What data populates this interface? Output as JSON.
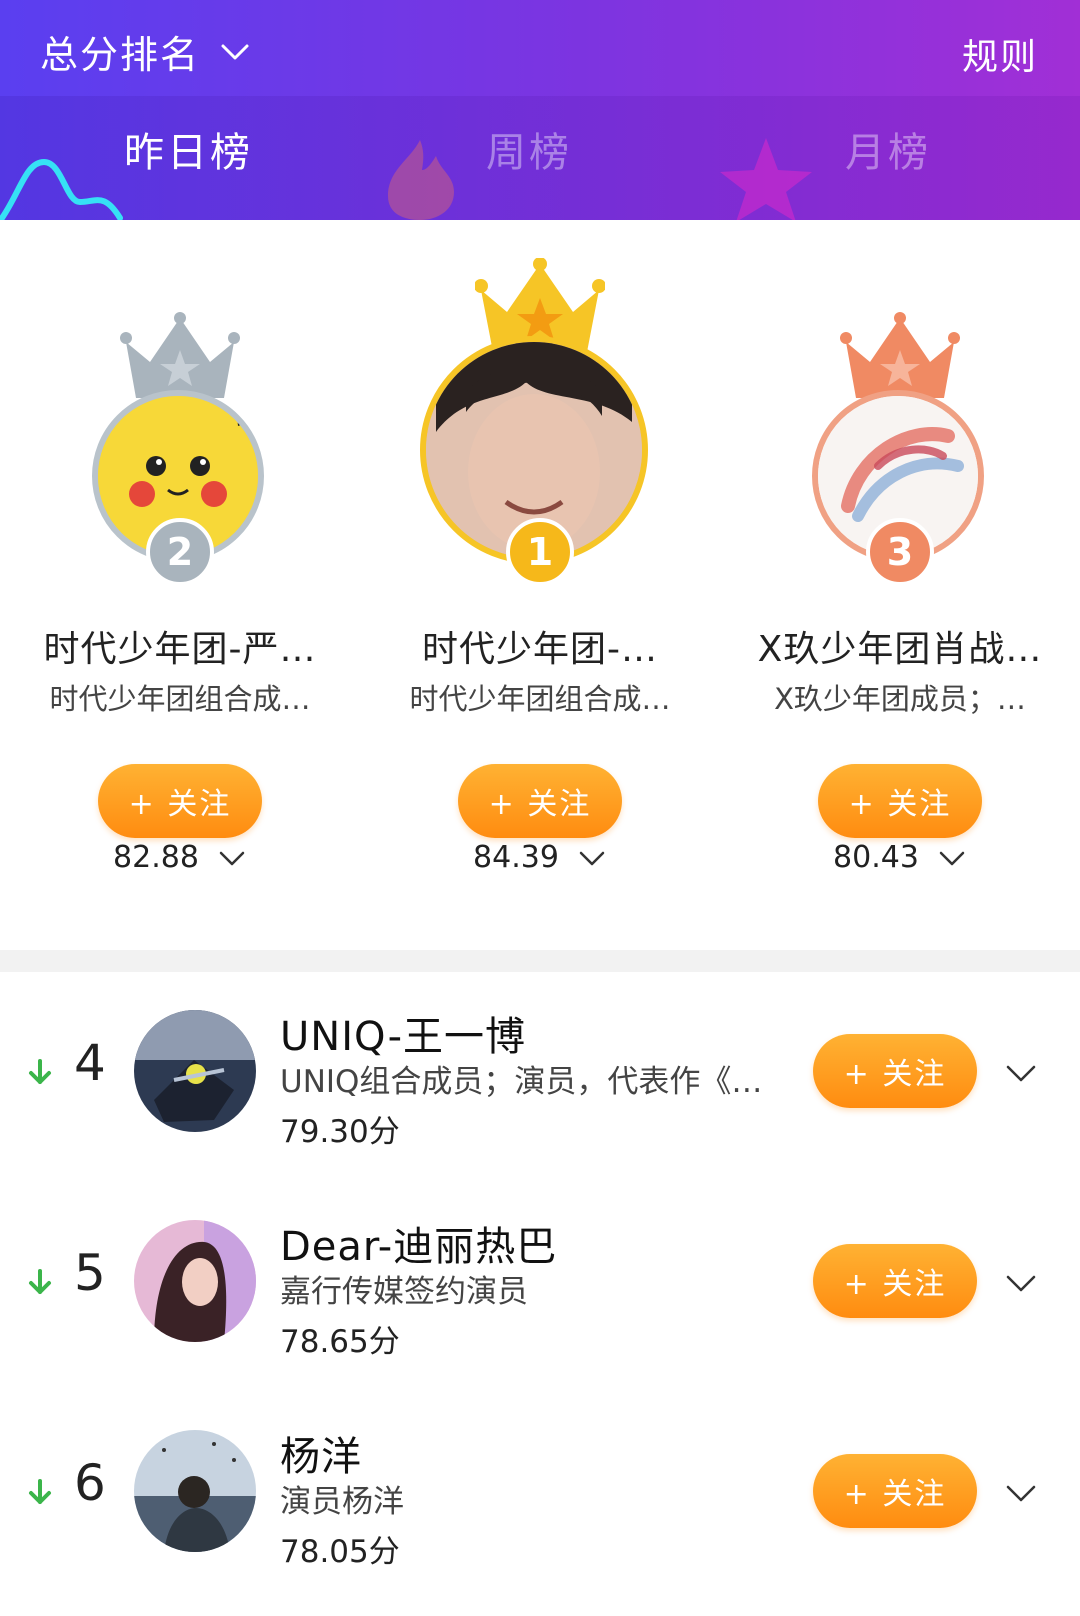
{
  "header": {
    "sort_label": "总分排名",
    "rules_label": "规则",
    "tabs": [
      {
        "label": "昨日榜",
        "active": true
      },
      {
        "label": "周榜",
        "active": false
      },
      {
        "label": "月榜",
        "active": false
      }
    ]
  },
  "colors": {
    "header_start": "#5a3ff0",
    "header_end": "#a12fd6",
    "follow_button": "#ff9a1f",
    "trend_down": "#3bb54a",
    "gold": "#f6c526",
    "silver": "#a9b4bd",
    "bronze": "#f08a63"
  },
  "podium": [
    {
      "rank": "2",
      "name": "时代少年团-严…",
      "desc": "时代少年团组合成…",
      "follow_label": "+ 关注",
      "score": "82.88",
      "medal": "silver",
      "avatar_icon": "pikachu-avatar"
    },
    {
      "rank": "1",
      "name": "时代少年团-…",
      "desc": "时代少年团组合成…",
      "follow_label": "+ 关注",
      "score": "84.39",
      "medal": "gold",
      "avatar_icon": "portrait-avatar"
    },
    {
      "rank": "3",
      "name": "X玖少年团肖战…",
      "desc": "X玖少年团成员；…",
      "follow_label": "+ 关注",
      "score": "80.43",
      "medal": "bronze",
      "avatar_icon": "brush-art-avatar"
    }
  ],
  "list": [
    {
      "rank": "4",
      "trend": "down",
      "name": "UNIQ-王一博",
      "desc": "UNIQ组合成员；演员，代表作《…",
      "score": "79.30分",
      "follow_label": "+ 关注"
    },
    {
      "rank": "5",
      "trend": "down",
      "name": "Dear-迪丽热巴",
      "desc": "嘉行传媒签约演员",
      "score": "78.65分",
      "follow_label": "+ 关注"
    },
    {
      "rank": "6",
      "trend": "down",
      "name": "杨洋",
      "desc": "演员杨洋",
      "score": "78.05分",
      "follow_label": "+ 关注"
    }
  ]
}
